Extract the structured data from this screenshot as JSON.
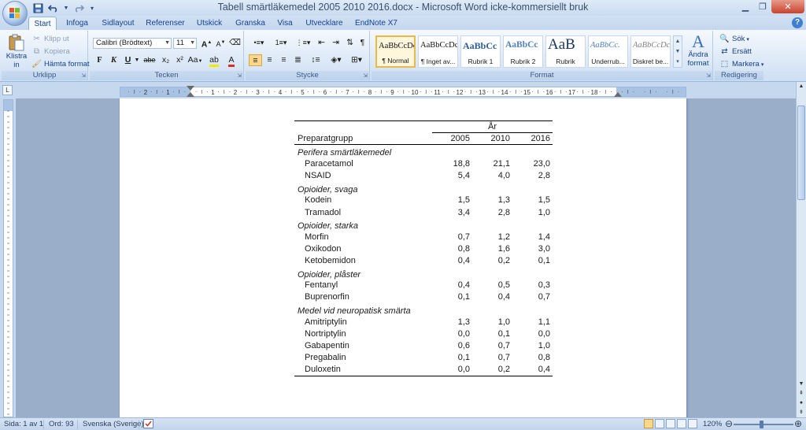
{
  "window": {
    "title": "Tabell smärtläkemedel 2005 2010 2016.docx - Microsoft Word icke-kommersiellt bruk",
    "quick_access": [
      "save-icon",
      "undo-icon",
      "redo-icon",
      "customize-icon"
    ]
  },
  "tabs": [
    "Start",
    "Infoga",
    "Sidlayout",
    "Referenser",
    "Utskick",
    "Granska",
    "Visa",
    "Utvecklare",
    "EndNote X7"
  ],
  "active_tab": "Start",
  "ribbon": {
    "clipboard": {
      "label": "Urklipp",
      "paste": "Klistra",
      "paste2": "in",
      "cut": "Klipp ut",
      "copy": "Kopiera",
      "format_painter": "Hämta format"
    },
    "font": {
      "label": "Tecken",
      "font_name": "Calibri (Brödtext)",
      "font_size": "11",
      "bold": "F",
      "italic": "K",
      "underline": "U",
      "strike": "abe",
      "subscript": "x₂",
      "superscript": "x²",
      "case": "Aa",
      "grow": "A",
      "shrink": "A"
    },
    "paragraph": {
      "label": "Stycke"
    },
    "styles": {
      "label": "Format",
      "items": [
        {
          "sample": "AaBbCcDc",
          "name": "¶ Normal"
        },
        {
          "sample": "AaBbCcDc",
          "name": "¶ Inget av..."
        },
        {
          "sample": "AaBbCc",
          "name": "Rubrik 1"
        },
        {
          "sample": "AaBbCc",
          "name": "Rubrik 2"
        },
        {
          "sample": "AaB",
          "name": "Rubrik"
        },
        {
          "sample": "AaBbCc.",
          "name": "Underrub..."
        },
        {
          "sample": "AaBbCcDc",
          "name": "Diskret be..."
        }
      ],
      "change_styles": "Ändra",
      "change_styles2": "format"
    },
    "editing": {
      "label": "Redigering",
      "find": "Sök",
      "replace": "Ersätt",
      "select": "Markera"
    }
  },
  "table": {
    "year_header": "År",
    "col_header": "Preparatgrupp",
    "years": [
      "2005",
      "2010",
      "2016"
    ],
    "groups": [
      {
        "name": "Perifera smärtläkemedel",
        "rows": [
          {
            "drug": "Paracetamol",
            "v": [
              "18,8",
              "21,1",
              "23,0"
            ]
          },
          {
            "drug": "NSAID",
            "v": [
              "5,4",
              "4,0",
              "2,8"
            ]
          }
        ]
      },
      {
        "name": "Opioider, svaga",
        "rows": [
          {
            "drug": "Kodein",
            "v": [
              "1,5",
              "1,3",
              "1,5"
            ]
          },
          {
            "drug": "Tramadol",
            "v": [
              "3,4",
              "2,8",
              "1,0"
            ]
          }
        ]
      },
      {
        "name": "Opioider, starka",
        "rows": [
          {
            "drug": "Morfin",
            "v": [
              "0,7",
              "1,2",
              "1,4"
            ]
          },
          {
            "drug": "Oxikodon",
            "v": [
              "0,8",
              "1,6",
              "3,0"
            ]
          },
          {
            "drug": "Ketobemidon",
            "v": [
              "0,4",
              "0,2",
              "0,1"
            ]
          }
        ]
      },
      {
        "name": "Opioider, plåster",
        "rows": [
          {
            "drug": "Fentanyl",
            "v": [
              "0,4",
              "0,5",
              "0,3"
            ]
          },
          {
            "drug": "Buprenorfin",
            "v": [
              "0,1",
              "0,4",
              "0,7"
            ]
          }
        ]
      },
      {
        "name": "Medel vid neuropatisk smärta",
        "rows": [
          {
            "drug": "Amitriptylin",
            "v": [
              "1,3",
              "1,0",
              "1,1"
            ]
          },
          {
            "drug": "Nortriptylin",
            "v": [
              "0,0",
              "0,1",
              "0,0"
            ]
          },
          {
            "drug": "Gabapentin",
            "v": [
              "0,6",
              "0,7",
              "1,0"
            ]
          },
          {
            "drug": "Pregabalin",
            "v": [
              "0,1",
              "0,7",
              "0,8"
            ]
          },
          {
            "drug": "Duloxetin",
            "v": [
              "0,0",
              "0,2",
              "0,4"
            ]
          }
        ]
      }
    ]
  },
  "ruler_numbers": [
    "2",
    "1",
    "1",
    "2",
    "3",
    "4",
    "5",
    "6",
    "7",
    "8",
    "9",
    "10",
    "11",
    "12",
    "13",
    "14",
    "15",
    "16",
    "17",
    "18"
  ],
  "status": {
    "page": "Sida: 1 av 1",
    "words": "Ord: 93",
    "language": "Svenska (Sverige)",
    "zoom": "120%"
  }
}
